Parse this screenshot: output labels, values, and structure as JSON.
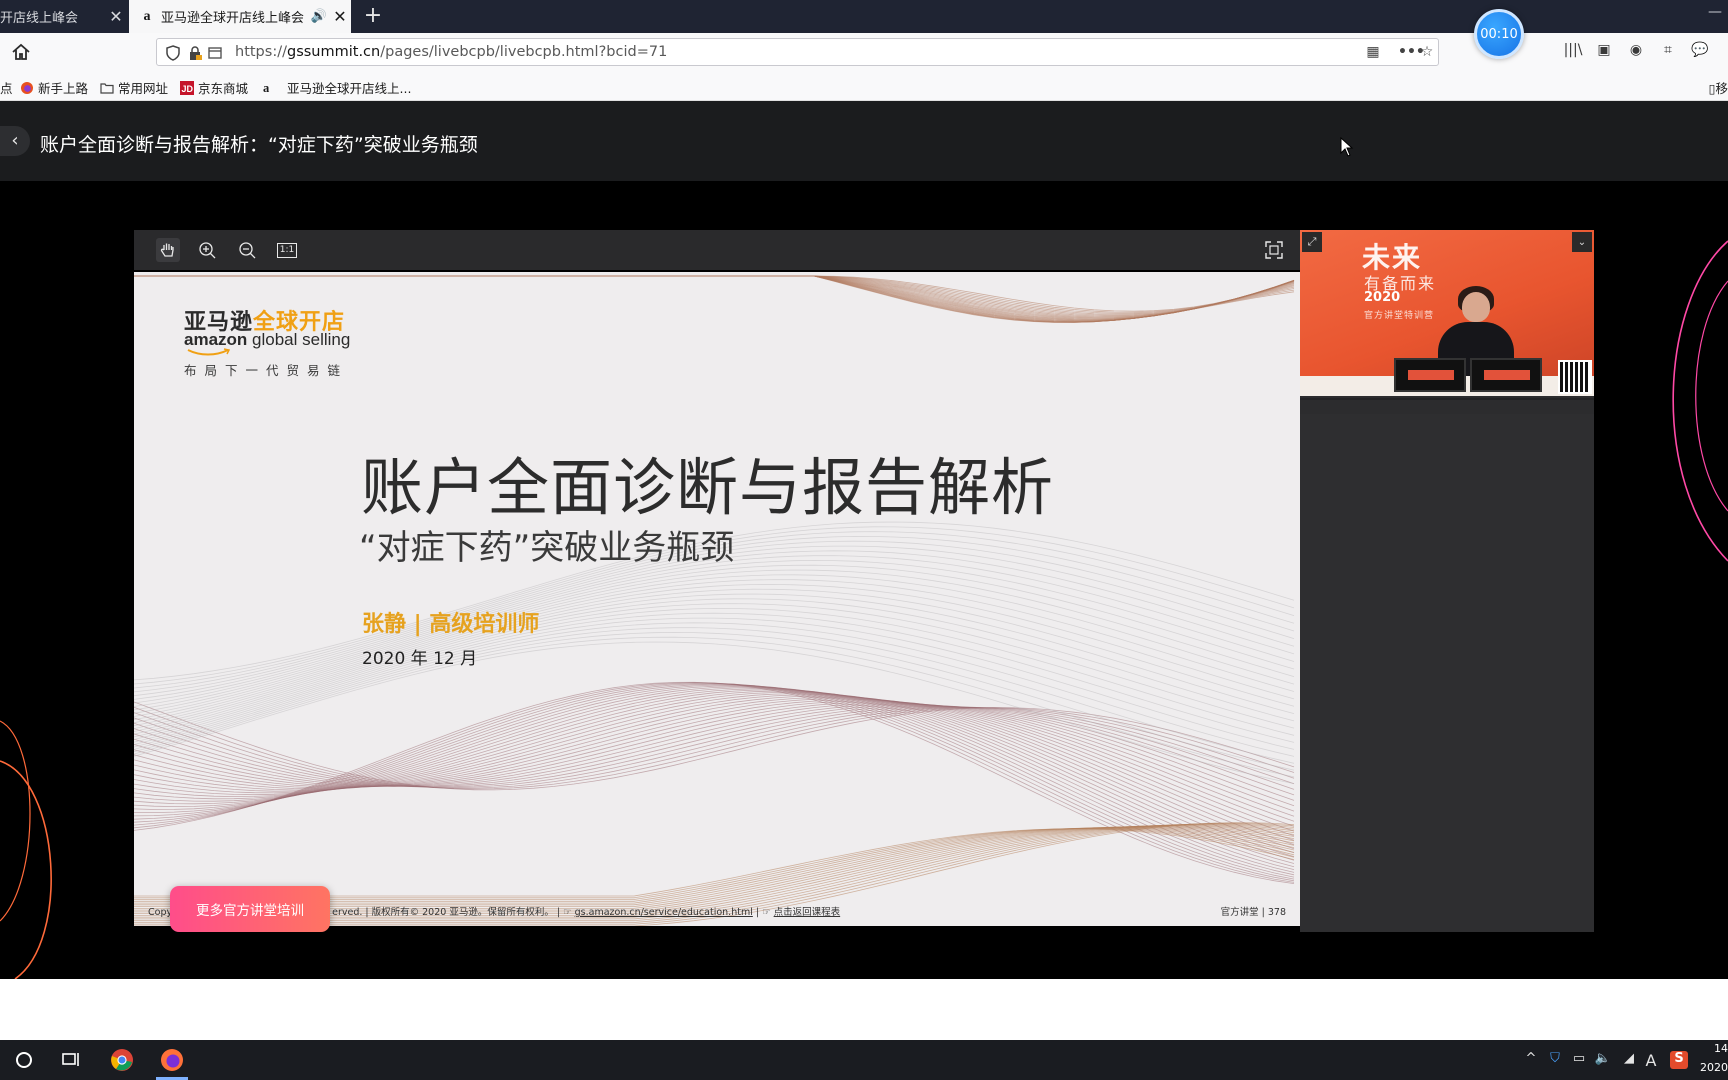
{
  "browser": {
    "tabs": [
      {
        "label": "开店线上峰会",
        "active": false
      },
      {
        "label": "亚马逊全球开店线上峰会",
        "active": true
      }
    ],
    "tab_favicon": "a",
    "new_tab_label": "+",
    "timer": "00:10",
    "url_prefix": "https://",
    "url_host": "gssummit.cn",
    "url_path": "/pages/livebcpb/livebcpb.html?bcid=71",
    "bookmarks": [
      {
        "label": "点",
        "icon": "none"
      },
      {
        "label": "新手上路",
        "icon": "firefox-icon"
      },
      {
        "label": "常用网址",
        "icon": "folder-icon"
      },
      {
        "label": "京东商城",
        "icon": "jd-icon"
      },
      {
        "label": "亚马逊全球开店线上...",
        "icon": "amazon-icon"
      }
    ],
    "bookmarks_right": "移"
  },
  "header": {
    "title": "账户全面诊断与报告解析：“对症下药”突破业务瓶颈",
    "back_glyph": "‹"
  },
  "slide_toolbar": {
    "reset_label": "1:1"
  },
  "slide": {
    "logo_cn_a": "亚马逊",
    "logo_cn_b": "全球开店",
    "logo_en_a": "amazon",
    "logo_en_b": " global selling",
    "slogan": "布局下一代贸易链",
    "title": "账户全面诊断与报告解析",
    "subtitle": "“对症下药”突破业务瓶颈",
    "author": "张静 | 高级培训师",
    "date": "2020 年 12 月",
    "footer_a": "Copy",
    "footer_b": "erved. | 版权所有© 2020 亚马逊。保留所有权利。 | ☞ ",
    "footer_link": "gs.amazon.cn/service/education.html",
    "footer_c": " | ☞ ",
    "footer_back": "点击返回课程表",
    "page": "官方讲堂 | 378"
  },
  "more_button": "更多官方讲堂培训",
  "video": {
    "big": "未来",
    "sub": "有备而来",
    "year": "2020",
    "line": "官方讲堂特训营"
  },
  "taskbar": {
    "clock_time": "14",
    "clock_date": "2020"
  },
  "colors": {
    "accent_orange": "#e6a21f",
    "button_pink": "#ff4d8a",
    "video_orange": "#f26a43"
  }
}
